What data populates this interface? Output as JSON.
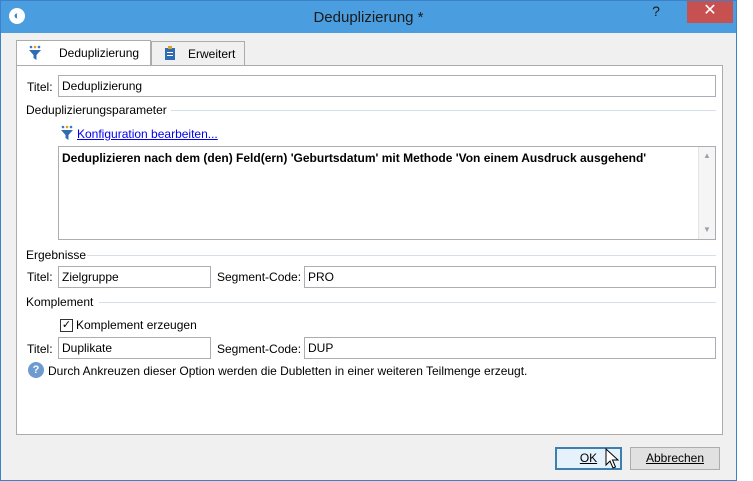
{
  "window": {
    "title": "Deduplizierung *"
  },
  "titlebar_buttons": {
    "help": "?",
    "close": "✕"
  },
  "tabs": [
    {
      "label": "Deduplizierung",
      "icon": "funnel-icon",
      "active": true
    },
    {
      "label": "Erweitert",
      "icon": "clipboard-icon",
      "active": false
    }
  ],
  "general": {
    "title_label": "Titel:",
    "title_value": "Deduplizierung"
  },
  "params": {
    "section_label": "Deduplizierungsparameter",
    "config_link": "Konfiguration bearbeiten...",
    "description": "Deduplizieren nach dem (den) Feld(ern) 'Geburtsdatum' mit Methode 'Von einem Ausdruck ausgehend'"
  },
  "results": {
    "section_label": "Ergebnisse",
    "title_label": "Titel:",
    "title_value": "Zielgruppe",
    "segment_label": "Segment-Code:",
    "segment_value": "PRO"
  },
  "complement": {
    "section_label": "Komplement",
    "checkbox_label": "Komplement erzeugen",
    "checked": true,
    "title_label": "Titel:",
    "title_value": "Duplikate",
    "segment_label": "Segment-Code:",
    "segment_value": "DUP",
    "help_text": "Durch Ankreuzen dieser Option werden die Dubletten in einer weiteren Teilmenge erzeugt."
  },
  "buttons": {
    "ok": "OK",
    "cancel": "Abbrechen"
  },
  "colors": {
    "titlebar": "#4a9ee0",
    "close": "#c75050",
    "link": "#0000ee"
  }
}
